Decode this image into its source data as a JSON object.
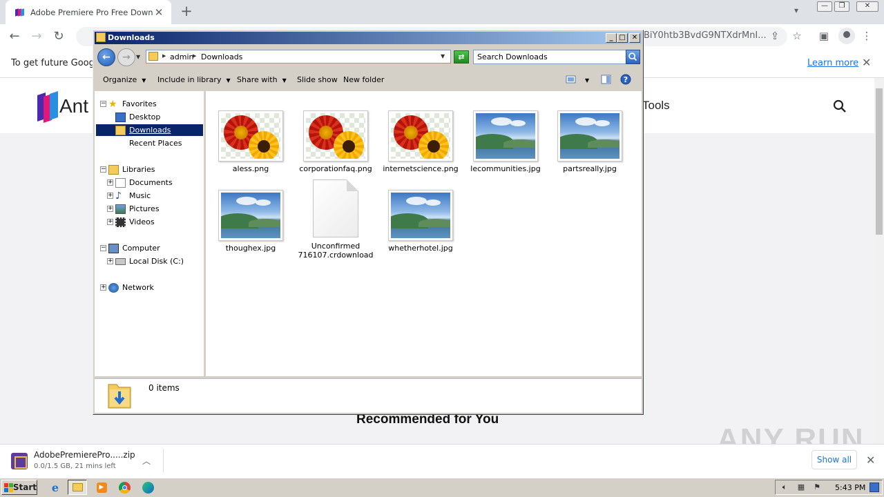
{
  "browser": {
    "tab_title": "Adobe Premiere Pro Free Download",
    "tab_close": "✕",
    "new_tab": "+",
    "url_visible_tail": "BiY0htb3BvdG9NTXdrMnI...",
    "info_text": "To get future Google",
    "learn_more": "Learn more",
    "info_close": "✕"
  },
  "site": {
    "name_visible": "Ant",
    "nav_tools_visible": "Tools",
    "section_heading": "Recommended for You",
    "watermark": "ANY RUN"
  },
  "download": {
    "file_name": "AdobePremierePro.....zip",
    "status": "0.0/1.5 GB, 21 mins left",
    "show_all": "Show all",
    "close": "✕"
  },
  "explorer": {
    "title": "Downloads",
    "breadcrumb": [
      "admin",
      "Downloads"
    ],
    "search_placeholder": "Search Downloads",
    "commands": {
      "organize": "Organize",
      "include_in_library": "Include in library",
      "share_with": "Share with",
      "slide_show": "Slide show",
      "new_folder": "New folder"
    },
    "nav": {
      "favorites": "Favorites",
      "desktop": "Desktop",
      "downloads": "Downloads",
      "recent_places": "Recent Places",
      "libraries": "Libraries",
      "documents": "Documents",
      "music": "Music",
      "pictures": "Pictures",
      "videos": "Videos",
      "computer": "Computer",
      "local_disk": "Local Disk (C:)",
      "network": "Network"
    },
    "files": [
      {
        "name": "aless.png",
        "thumb": "flower"
      },
      {
        "name": "corporationfaq.png",
        "thumb": "flower"
      },
      {
        "name": "internetscience.png",
        "thumb": "flower"
      },
      {
        "name": "lecommunities.jpg",
        "thumb": "landscape"
      },
      {
        "name": "partsreally.jpg",
        "thumb": "landscape"
      },
      {
        "name": "thoughex.jpg",
        "thumb": "landscape"
      },
      {
        "name": "Unconfirmed 716107.crdownload",
        "thumb": "document"
      },
      {
        "name": "whetherhotel.jpg",
        "thumb": "landscape"
      }
    ],
    "status_items": "0 items"
  },
  "taskbar": {
    "start": "Start",
    "clock": "5:43 PM"
  },
  "colors": {
    "title_gradient_start": "#0a246a",
    "selection": "#0a246a",
    "link_blue": "#1a73e8",
    "classic_gray": "#d4d0c8"
  }
}
